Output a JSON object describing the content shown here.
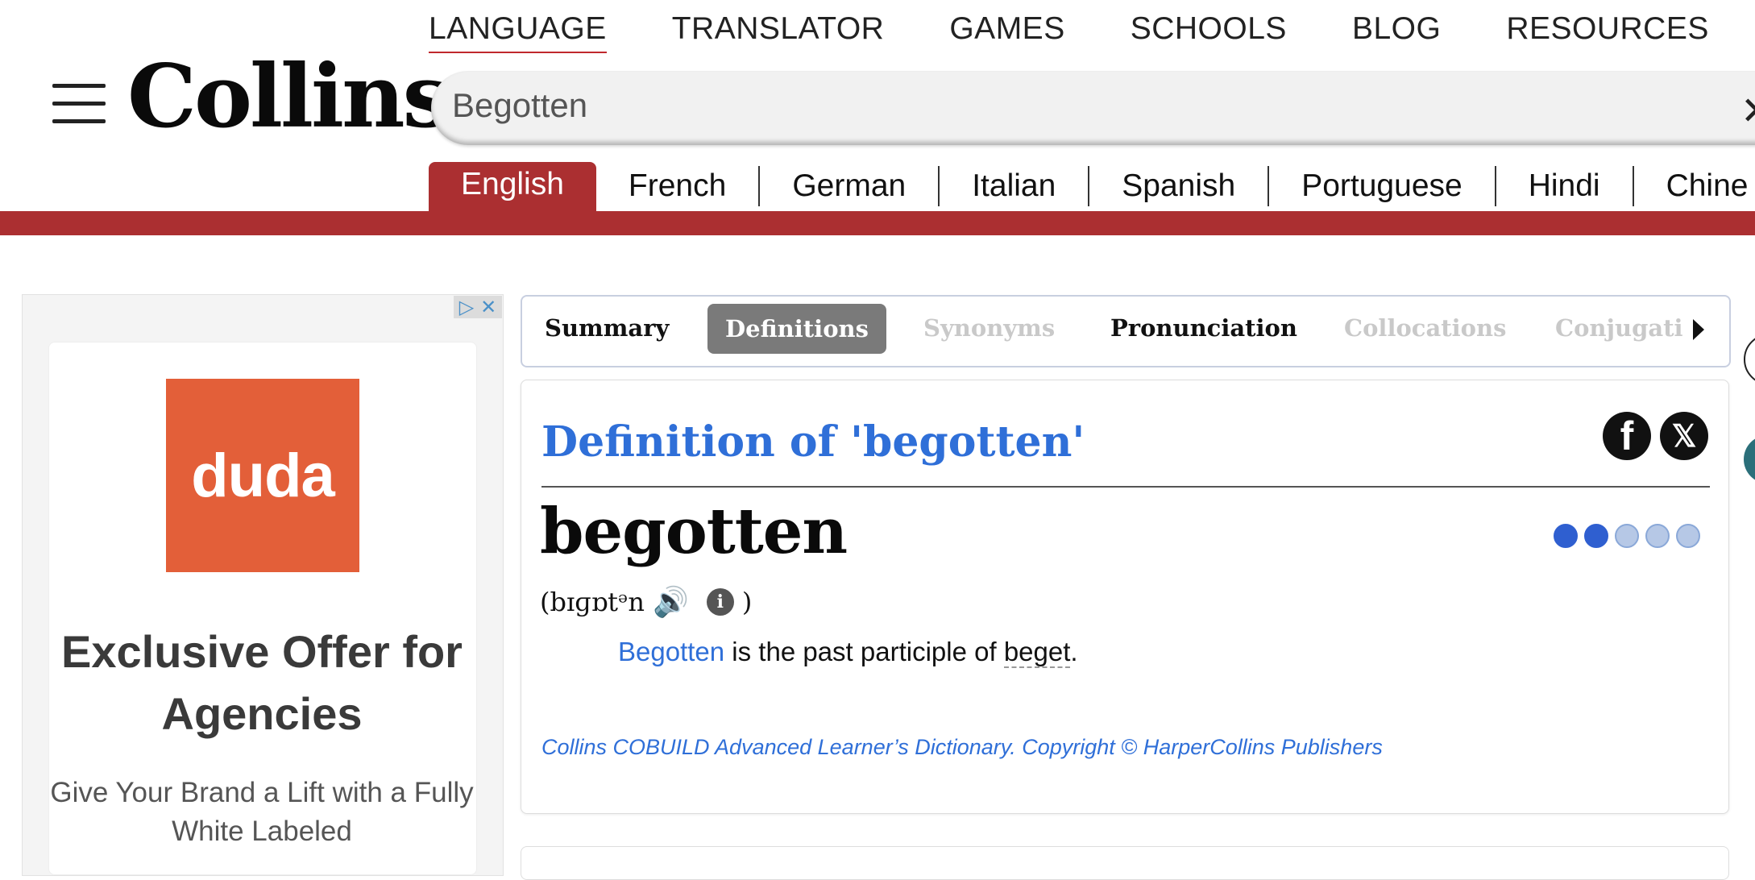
{
  "header": {
    "logo": "Collins",
    "topnav": [
      "LANGUAGE",
      "TRANSLATOR",
      "GAMES",
      "SCHOOLS",
      "BLOG",
      "RESOURCES"
    ],
    "search": {
      "value": "Begotten",
      "clear_icon": "close-icon"
    },
    "languages": [
      "English",
      "French",
      "German",
      "Italian",
      "Spanish",
      "Portuguese",
      "Hindi",
      "Chine"
    ],
    "active_language": "English",
    "accent_color": "#ab2f31"
  },
  "ad": {
    "logo_text": "duda",
    "title": "Exclusive Offer for Agencies",
    "body": "Give Your Brand a Lift with a Fully White Labeled",
    "brand_color": "#e35f39"
  },
  "tabs": {
    "items": [
      {
        "label": "Summary",
        "state": "normal"
      },
      {
        "label": "Definitions",
        "state": "active"
      },
      {
        "label": "Synonyms",
        "state": "disabled"
      },
      {
        "label": "Pronunciation",
        "state": "normal"
      },
      {
        "label": "Collocations",
        "state": "disabled"
      },
      {
        "label": "Conjugati",
        "state": "disabled"
      }
    ]
  },
  "definition": {
    "title": "Definition of 'begotten'",
    "headword": "begotten",
    "frequency": 2,
    "frequency_max": 5,
    "pron_open": "(",
    "pronunciation": "bɪɡɒtᵊn",
    "pron_close": ")",
    "sense_word": "Begotten",
    "sense_mid": " is the past participle of ",
    "sense_xref": "beget",
    "sense_end": ".",
    "copyright": "Collins COBUILD Advanced Learner’s Dictionary. Copyright © HarperCollins Publishers",
    "link_color": "#2f6fd8"
  }
}
